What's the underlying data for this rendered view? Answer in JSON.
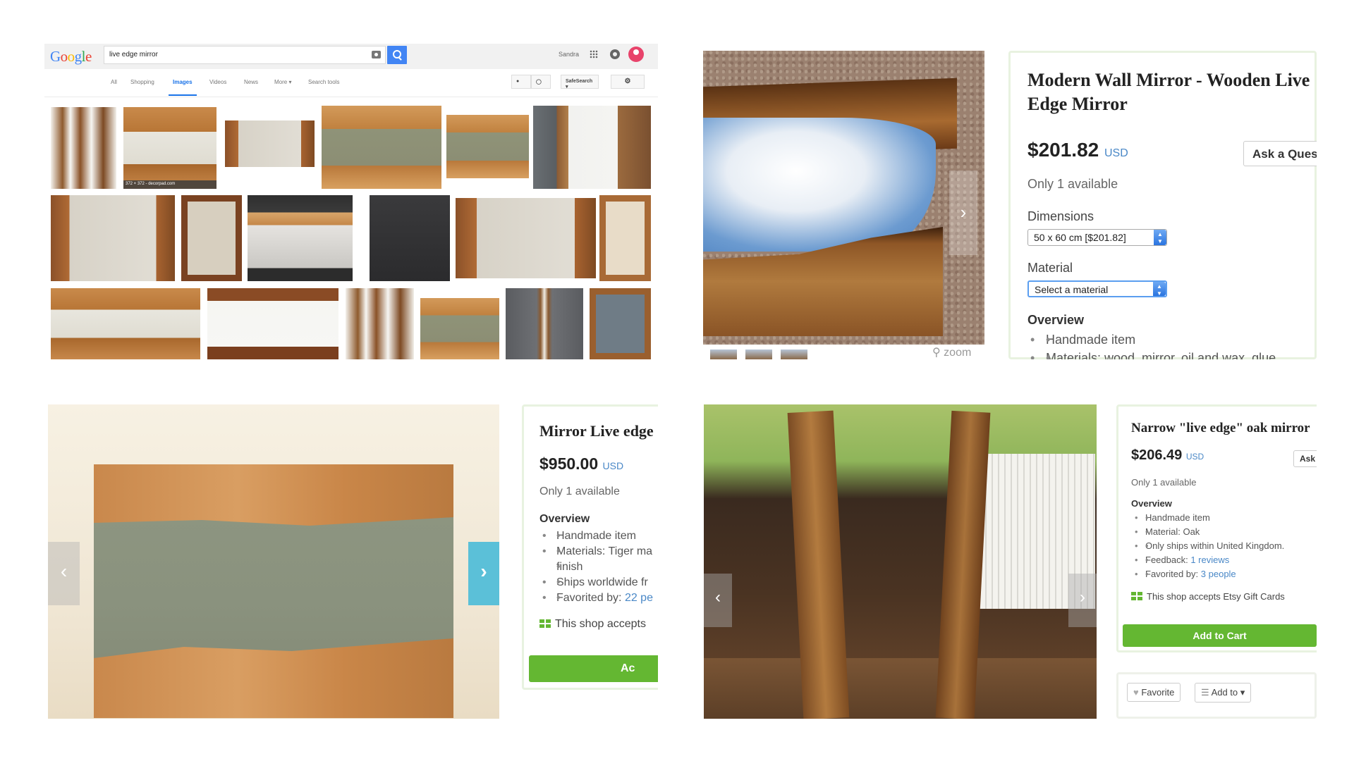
{
  "google": {
    "logo": [
      "G",
      "o",
      "o",
      "g",
      "l",
      "e"
    ],
    "query": "live edge mirror",
    "user": "Sandra",
    "tabs": [
      "All",
      "Shopping",
      "Images",
      "Videos",
      "News",
      "More ▾",
      "Search tools"
    ],
    "active_tab": "Images",
    "safesearch": "SafeSearch ▾",
    "thumb_caption": "372 × 372 - decorpad.com"
  },
  "listing1": {
    "title": "Modern Wall Mirror - Wooden Live Edge Mirror",
    "price": "$201.82",
    "currency": "USD",
    "ask_label": "Ask a Question",
    "availability": "Only 1 available",
    "dimensions_label": "Dimensions",
    "dimensions_value": "50 x 60 cm [$201.82]",
    "material_label": "Material",
    "material_placeholder": "Select a material",
    "overview_label": "Overview",
    "overview_items": [
      "Handmade item",
      "Materials: wood, mirror, oil and wax, glue"
    ],
    "zoom_label": "zoom"
  },
  "listing2": {
    "title": "Mirror Live edge",
    "price": "$950.00",
    "currency": "USD",
    "availability": "Only 1 available",
    "overview_label": "Overview",
    "item1": "Handmade item",
    "item2": "Materials: Tiger ma",
    "item2b": "finish",
    "item3": "Ships worldwide fr",
    "item4_prefix": "Favorited by:",
    "item4_link": "22 pe",
    "gift_text": "This shop accepts",
    "cart_label": "Ac"
  },
  "listing3": {
    "title": "Narrow \"live edge\" oak mirror",
    "price": "$206.49",
    "currency": "USD",
    "ask_label": "Ask",
    "availability": "Only 1 available",
    "overview_label": "Overview",
    "item1": "Handmade item",
    "item2": "Material: Oak",
    "item3": "Only ships within United Kingdom.",
    "item4_prefix": "Feedback:",
    "item4_link": "1 reviews",
    "item5_prefix": "Favorited by:",
    "item5_link": "3 people",
    "gift_text": "This shop accepts Etsy Gift Cards",
    "cart_label": "Add to Cart",
    "favorite_label": "Favorite",
    "addto_label": "Add to ▾"
  },
  "colors": {
    "google_blue": "#4285f4",
    "etsy_green": "#64b732",
    "link_blue": "#4a88c7",
    "carousel_cyan": "#5bc0d8"
  }
}
